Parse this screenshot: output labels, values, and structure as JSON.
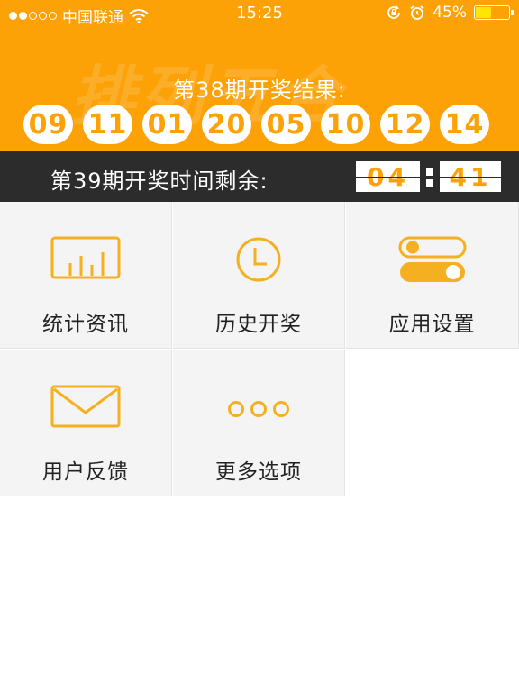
{
  "status_bar": {
    "carrier": "中国联通",
    "time": "15:25",
    "battery": "45%",
    "battery_level": 0.45,
    "signal_bars_filled": 2,
    "signal_bars_total": 5,
    "icons": [
      "wifi-icon",
      "orientation-lock-icon",
      "alarm-icon",
      "battery-icon"
    ]
  },
  "header": {
    "watermark": "排列五合",
    "result_title": "第38期开奖结果:",
    "numbers": [
      "09",
      "11",
      "01",
      "20",
      "05",
      "10",
      "12",
      "14"
    ],
    "accent_color": "#fca106"
  },
  "countdown": {
    "label": "第39期开奖时间剩余:",
    "minutes": "04",
    "seconds": "41",
    "bar_color": "#2c2c2c"
  },
  "menu": [
    {
      "label": "统计资讯",
      "icon": "bar-chart-icon"
    },
    {
      "label": "历史开奖",
      "icon": "clock-icon"
    },
    {
      "label": "应用设置",
      "icon": "toggle-switches-icon"
    },
    {
      "label": "用户反馈",
      "icon": "envelope-icon"
    },
    {
      "label": "更多选项",
      "icon": "more-dots-icon"
    }
  ]
}
